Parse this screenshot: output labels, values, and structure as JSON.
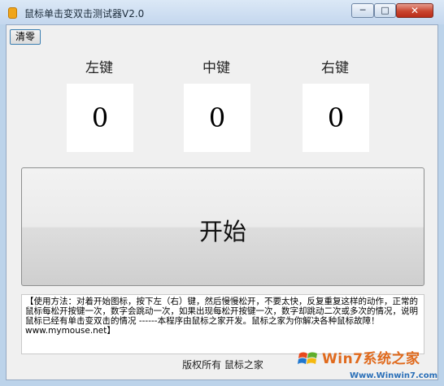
{
  "window": {
    "title": "鼠标单击变双击测试器V2.0"
  },
  "controls": {
    "minimize": "─",
    "maximize": "□",
    "close": "✕"
  },
  "toolbar": {
    "clear_label": "清零"
  },
  "buttons": [
    {
      "label": "左键",
      "count": "0"
    },
    {
      "label": "中键",
      "count": "0"
    },
    {
      "label": "右键",
      "count": "0"
    }
  ],
  "start": {
    "label": "开始"
  },
  "info": {
    "text": "【使用方法：对着开始图标，按下左（右）键，然后慢慢松开，不要太快，反复重复这样的动作，正常的鼠标每松开按键一次，数字会跳动一次，如果出现每松开按键一次，数字却跳动二次或多次的情况，说明鼠标已经有单击变双击的情况 ------本程序由鼠标之家开发。鼠标之家为你解决各种鼠标故障！ www.mymouse.net】"
  },
  "footer": {
    "text": "版权所有 鼠标之家"
  },
  "watermark": {
    "brand": "Win7系统之家",
    "url": "Www.Winwin7.com"
  }
}
